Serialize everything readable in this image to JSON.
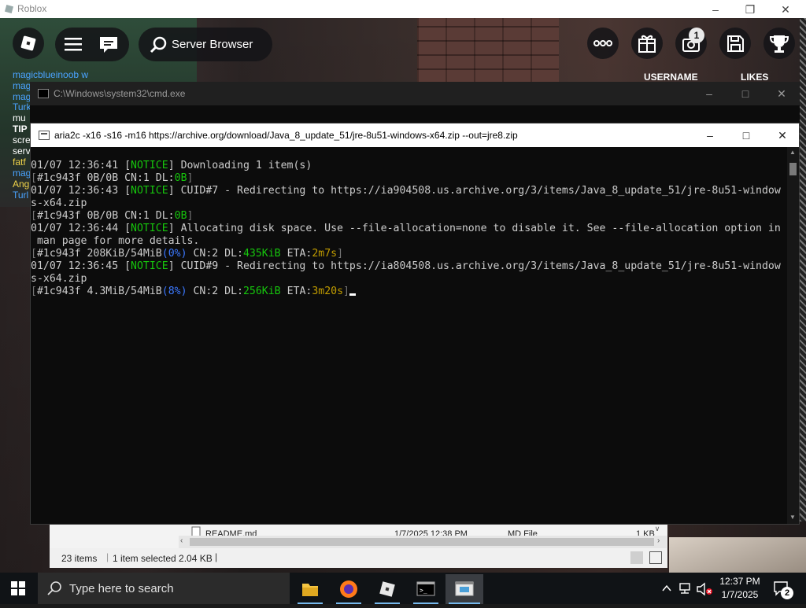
{
  "roblox": {
    "window_title": "Roblox",
    "server_browser_label": "Server Browser",
    "notification_count": "1",
    "leaderboard_headers": [
      "USERNAME",
      "LIKES"
    ],
    "chat_fragments": [
      {
        "text": "magicblueinoob  w",
        "color": "#4aa3ff"
      },
      {
        "text": "mag",
        "color": "#4aa3ff"
      },
      {
        "text": "mag",
        "color": "#4aa3ff"
      },
      {
        "text": "Turk",
        "color": "#4aa3ff"
      },
      {
        "text": "mu",
        "color": "#ffffff"
      },
      {
        "text": "TIP",
        "color": "#ffffff"
      },
      {
        "text": "scre",
        "color": "#ffffff"
      },
      {
        "text": "serv",
        "color": "#ffffff"
      },
      {
        "text": "fatf",
        "color": "#f0d34a"
      },
      {
        "text": "mag",
        "color": "#4aa3ff"
      },
      {
        "text": "Ang",
        "color": "#f0d34a"
      },
      {
        "text": "Turl",
        "color": "#4aa3ff"
      }
    ]
  },
  "cmd_back": {
    "title": "C:\\Windows\\system32\\cmd.exe"
  },
  "aria": {
    "title": "aria2c  -x16 -s16 -m16 https://archive.org/download/Java_8_update_51/jre-8u51-windows-x64.zip --out=jre8.zip",
    "lines": [
      [
        {
          "t": "01/07 12:36:41 ["
        },
        {
          "t": "NOTICE",
          "c": "g"
        },
        {
          "t": "] Downloading 1 item(s)"
        }
      ],
      [
        {
          "t": "[",
          "c": "dim"
        },
        {
          "t": "#1c943f 0B/0B CN:1 DL:"
        },
        {
          "t": "0B",
          "c": "g"
        },
        {
          "t": "]",
          "c": "dim"
        }
      ],
      [
        {
          "t": "01/07 12:36:43 ["
        },
        {
          "t": "NOTICE",
          "c": "g"
        },
        {
          "t": "] CUID#7 - Redirecting to https://ia904508.us.archive.org/3/items/Java_8_update_51/jre-8u51-window"
        }
      ],
      [
        {
          "t": "s-x64.zip"
        }
      ],
      [
        {
          "t": "[",
          "c": "dim"
        },
        {
          "t": "#1c943f 0B/0B CN:1 DL:"
        },
        {
          "t": "0B",
          "c": "g"
        },
        {
          "t": "]",
          "c": "dim"
        }
      ],
      [
        {
          "t": "01/07 12:36:44 ["
        },
        {
          "t": "NOTICE",
          "c": "g"
        },
        {
          "t": "] Allocating disk space. Use --file-allocation=none to disable it. See --file-allocation option in"
        }
      ],
      [
        {
          "t": " man page for more details."
        }
      ],
      [
        {
          "t": "[",
          "c": "dim"
        },
        {
          "t": "#1c943f 208KiB/54MiB"
        },
        {
          "t": "(0%)",
          "c": "b"
        },
        {
          "t": " CN:2 DL:"
        },
        {
          "t": "435KiB",
          "c": "g"
        },
        {
          "t": " ETA:"
        },
        {
          "t": "2m7s",
          "c": "y"
        },
        {
          "t": "]",
          "c": "dim"
        }
      ],
      [
        {
          "t": "01/07 12:36:45 ["
        },
        {
          "t": "NOTICE",
          "c": "g"
        },
        {
          "t": "] CUID#9 - Redirecting to https://ia804508.us.archive.org/3/items/Java_8_update_51/jre-8u51-window"
        }
      ],
      [
        {
          "t": "s-x64.zip"
        }
      ],
      [
        {
          "t": "[",
          "c": "dim"
        },
        {
          "t": "#1c943f 4.3MiB/54MiB"
        },
        {
          "t": "(8%)",
          "c": "b"
        },
        {
          "t": " CN:2 DL:"
        },
        {
          "t": "256KiB",
          "c": "g"
        },
        {
          "t": " ETA:"
        },
        {
          "t": "3m20s",
          "c": "y"
        },
        {
          "t": "]",
          "c": "dim"
        },
        {
          "cursor": true
        }
      ]
    ]
  },
  "explorer": {
    "row": {
      "name": "README.md",
      "date": "1/7/2025 12:38 PM",
      "type": "MD File",
      "size": "1 KB"
    },
    "status_items": "23 items",
    "status_selected": "1 item selected  2.04 KB"
  },
  "taskbar": {
    "search_placeholder": "Type here to search",
    "time": "12:37 PM",
    "date": "1/7/2025",
    "notification_count": "2"
  }
}
